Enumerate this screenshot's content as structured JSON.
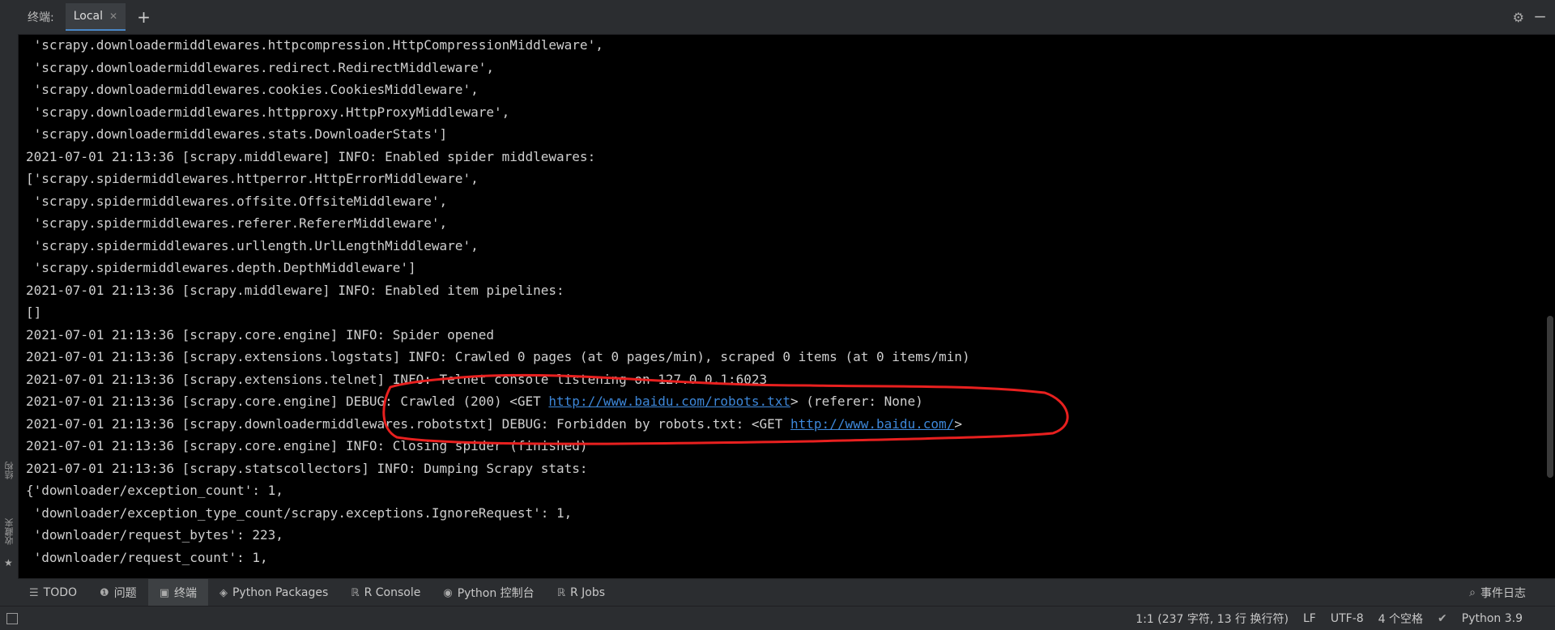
{
  "header": {
    "terminal_label": "终端:",
    "tab_label": "Local"
  },
  "sidebar": {
    "structure_label": "结构",
    "favorites_label": "收藏夹"
  },
  "console": {
    "lines": [
      " 'scrapy.downloadermiddlewares.httpcompression.HttpCompressionMiddleware',",
      " 'scrapy.downloadermiddlewares.redirect.RedirectMiddleware',",
      " 'scrapy.downloadermiddlewares.cookies.CookiesMiddleware',",
      " 'scrapy.downloadermiddlewares.httpproxy.HttpProxyMiddleware',",
      " 'scrapy.downloadermiddlewares.stats.DownloaderStats']",
      "2021-07-01 21:13:36 [scrapy.middleware] INFO: Enabled spider middlewares:",
      "['scrapy.spidermiddlewares.httperror.HttpErrorMiddleware',",
      " 'scrapy.spidermiddlewares.offsite.OffsiteMiddleware',",
      " 'scrapy.spidermiddlewares.referer.RefererMiddleware',",
      " 'scrapy.spidermiddlewares.urllength.UrlLengthMiddleware',",
      " 'scrapy.spidermiddlewares.depth.DepthMiddleware']",
      "2021-07-01 21:13:36 [scrapy.middleware] INFO: Enabled item pipelines:",
      "[]",
      "2021-07-01 21:13:36 [scrapy.core.engine] INFO: Spider opened",
      "2021-07-01 21:13:36 [scrapy.extensions.logstats] INFO: Crawled 0 pages (at 0 pages/min), scraped 0 items (at 0 items/min)",
      "2021-07-01 21:13:36 [scrapy.extensions.telnet] INFO: Telnet console listening on 127.0.0.1:6023"
    ],
    "crawled_line": {
      "prefix": "2021-07-01 21:13:36 [scrapy.core.engine] DEBUG: Crawled (200) <GET ",
      "url": "http://www.baidu.com/robots.txt",
      "suffix": "> (referer: None)"
    },
    "forbidden_line": {
      "prefix": "2021-07-01 21:13:36 [scrapy.downloadermiddlewares.robotstxt] DEBUG: Forbidden by robots.txt: <GET ",
      "url": "http://www.baidu.com/",
      "suffix": ">"
    },
    "lines_after": [
      "2021-07-01 21:13:36 [scrapy.core.engine] INFO: Closing spider (finished)",
      "2021-07-01 21:13:36 [scrapy.statscollectors] INFO: Dumping Scrapy stats:",
      "{'downloader/exception_count': 1,",
      " 'downloader/exception_type_count/scrapy.exceptions.IgnoreRequest': 1,",
      " 'downloader/request_bytes': 223,",
      " 'downloader/request_count': 1,"
    ]
  },
  "toolwindows": [
    {
      "icon": "list-icon",
      "glyph": "☰",
      "label": "TODO"
    },
    {
      "icon": "problems-icon",
      "glyph": "❶",
      "label": "问题"
    },
    {
      "icon": "terminal-icon",
      "glyph": "▣",
      "label": "终端"
    },
    {
      "icon": "packages-icon",
      "glyph": "◈",
      "label": "Python Packages"
    },
    {
      "icon": "r-console-icon",
      "glyph": "ℝ",
      "label": "R Console"
    },
    {
      "icon": "python-console-icon",
      "glyph": "◉",
      "label": "Python 控制台"
    },
    {
      "icon": "r-jobs-icon",
      "glyph": "ℝ",
      "label": "R Jobs"
    }
  ],
  "event_log_label": "事件日志",
  "statusbar": {
    "position": "1:1 (237 字符, 13 行 换行符)",
    "line_ending": "LF",
    "encoding": "UTF-8",
    "indent": "4 个空格",
    "interpreter": "Python 3.9"
  },
  "colors": {
    "annotation": "#e8201f",
    "link": "#3d87d9",
    "active_tab_underline": "#4a88c7"
  }
}
